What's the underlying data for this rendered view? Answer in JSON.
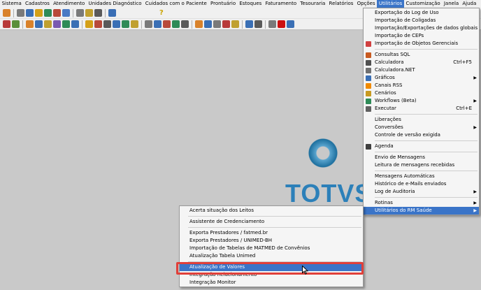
{
  "menubar": {
    "items": [
      "Sistema",
      "Cadastros",
      "Atendimento",
      "Unidades Diagnóstico",
      "Cuidados com o Paciente",
      "Prontuário",
      "Estoques",
      "Faturamento",
      "Tesouraria",
      "Relatórios",
      "Opções",
      "Utilitários",
      "Customização",
      "Janela",
      "Ajuda"
    ],
    "active": "Utilitários"
  },
  "toolbar_icons": [
    "toolbar-icon"
  ],
  "logo": {
    "text": "TOTVS"
  },
  "utilitarios_menu": {
    "items": [
      {
        "label": "Exportação do Log de Uso",
        "icon": ""
      },
      {
        "label": "Importação de Coligadas",
        "icon": ""
      },
      {
        "label": "Importação/Exportações de dados globais",
        "icon": ""
      },
      {
        "label": "Importação de CEPs",
        "icon": ""
      },
      {
        "label": "Importação de Objetos Gerenciais",
        "icon": "import-objects-icon"
      },
      {
        "divider": true
      },
      {
        "label": "Consultas SQL",
        "icon": "sql-query-icon"
      },
      {
        "label": "Calculadora",
        "shortcut": "Ctrl+F5",
        "icon": "calculator-icon"
      },
      {
        "label": "Calculadora.NET",
        "icon": "calculator-net-icon"
      },
      {
        "label": "Gráficos",
        "submenu": true,
        "icon": "chart-icon"
      },
      {
        "label": "Canais RSS",
        "icon": "rss-icon"
      },
      {
        "label": "Cenários",
        "icon": "scenario-icon"
      },
      {
        "label": "Workflows (Beta)",
        "submenu": true,
        "icon": "workflow-icon"
      },
      {
        "label": "Executar",
        "shortcut": "Ctrl+E",
        "icon": "execute-icon"
      },
      {
        "divider": true
      },
      {
        "label": "Liberações",
        "icon": ""
      },
      {
        "label": "Conversões",
        "submenu": true,
        "icon": ""
      },
      {
        "label": "Controle de versão exigida",
        "icon": ""
      },
      {
        "divider": true
      },
      {
        "label": "Agenda",
        "icon": "agenda-icon"
      },
      {
        "divider": true
      },
      {
        "label": "Envio de Mensagens",
        "icon": ""
      },
      {
        "label": "Leitura de mensagens recebidas",
        "icon": ""
      },
      {
        "divider": true
      },
      {
        "label": "Mensagens Automáticas",
        "icon": ""
      },
      {
        "label": "Histórico de e-Mails enviados",
        "icon": ""
      },
      {
        "label": "Log de Auditoria",
        "submenu": true,
        "icon": ""
      },
      {
        "divider": true
      },
      {
        "label": "Rotinas",
        "submenu": true,
        "icon": ""
      },
      {
        "label": "Utilitários do RM Saúde",
        "submenu": true,
        "highlight": true,
        "icon": ""
      }
    ]
  },
  "rm_saude_submenu": {
    "items": [
      {
        "label": "Acerta situação dos Leitos"
      },
      {
        "divider": true
      },
      {
        "label": "Assistente de Credenciamento"
      },
      {
        "divider": true
      },
      {
        "label": "Exporta Prestadores / fatmed.br"
      },
      {
        "label": "Exporta Prestadores / UNIMED-BH"
      },
      {
        "label": "Importação de Tabelas de MATMED de Convênios"
      },
      {
        "label": "Atualização Tabela Unimed"
      },
      {
        "divider": true
      },
      {
        "label": "Atualização de Valores",
        "highlight": true
      },
      {
        "label": "Integração Relacionamento"
      },
      {
        "label": "Integração Monitor"
      }
    ]
  },
  "colors": {
    "menu_highlight": "#3a74c8",
    "annotation_outline": "#e0403a",
    "logo_blue": "#2c80b9"
  }
}
